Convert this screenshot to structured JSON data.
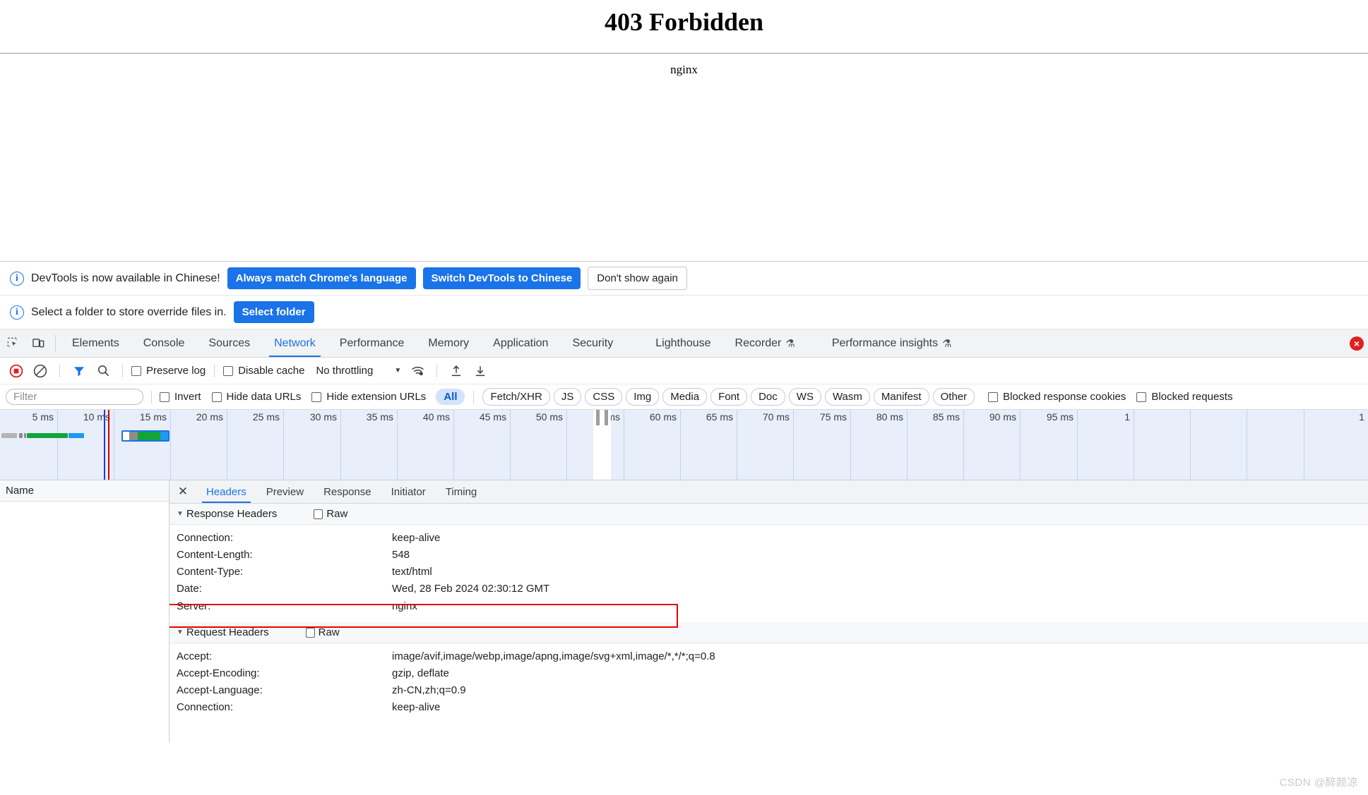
{
  "page": {
    "title": "403 Forbidden",
    "server": "nginx"
  },
  "notifications": [
    {
      "icon": "info-icon",
      "text": "DevTools is now available in Chinese!",
      "primary_button": "Always match Chrome's language",
      "secondary_button": "Switch DevTools to Chinese",
      "tertiary_button": "Don't show again"
    },
    {
      "icon": "info-icon",
      "text": "Select a folder to store override files in.",
      "primary_button": "Select folder"
    }
  ],
  "devtools": {
    "left_icons": [
      "inspect-element-icon",
      "device-toolbar-icon"
    ],
    "tabs": [
      {
        "label": "Elements",
        "active": false,
        "experimental": false
      },
      {
        "label": "Console",
        "active": false,
        "experimental": false
      },
      {
        "label": "Sources",
        "active": false,
        "experimental": false
      },
      {
        "label": "Network",
        "active": true,
        "experimental": false
      },
      {
        "label": "Performance",
        "active": false,
        "experimental": false
      },
      {
        "label": "Memory",
        "active": false,
        "experimental": false
      },
      {
        "label": "Application",
        "active": false,
        "experimental": false
      },
      {
        "label": "Security",
        "active": false,
        "experimental": false
      },
      {
        "label": "Lighthouse",
        "active": false,
        "experimental": false
      },
      {
        "label": "Recorder",
        "active": false,
        "experimental": true
      },
      {
        "label": "Performance insights",
        "active": false,
        "experimental": true
      }
    ],
    "error_badge": "×",
    "accent_color": "#1a73e8",
    "error_color": "#e02020"
  },
  "network_toolbar": {
    "record_icon": "record-stop-icon",
    "clear_icon": "clear-network-log-icon",
    "filter_icon": "filter-funnel-icon",
    "search_icon": "search-icon",
    "preserve_log_label": "Preserve log",
    "preserve_log_checked": false,
    "disable_cache_label": "Disable cache",
    "disable_cache_checked": false,
    "throttling_value": "No throttling",
    "network_conditions_icon": "wifi-settings-icon",
    "import_har_icon": "import-har-icon",
    "export_har_icon": "export-har-icon"
  },
  "filter_bar": {
    "filter_placeholder": "Filter",
    "filter_value": "",
    "invert_label": "Invert",
    "invert_checked": false,
    "hide_data_urls_label": "Hide data URLs",
    "hide_data_urls_checked": false,
    "hide_extension_urls_label": "Hide extension URLs",
    "hide_extension_urls_checked": false,
    "type_filters": [
      {
        "label": "All",
        "active": true
      },
      {
        "label": "Fetch/XHR",
        "active": false
      },
      {
        "label": "JS",
        "active": false
      },
      {
        "label": "CSS",
        "active": false
      },
      {
        "label": "Img",
        "active": false
      },
      {
        "label": "Media",
        "active": false
      },
      {
        "label": "Font",
        "active": false
      },
      {
        "label": "Doc",
        "active": false
      },
      {
        "label": "WS",
        "active": false
      },
      {
        "label": "Wasm",
        "active": false
      },
      {
        "label": "Manifest",
        "active": false
      },
      {
        "label": "Other",
        "active": false
      }
    ],
    "blocked_response_cookies_label": "Blocked response cookies",
    "blocked_response_cookies_checked": false,
    "blocked_requests_label": "Blocked requests",
    "blocked_requests_checked": false
  },
  "overview": {
    "ticks": [
      "5 ms",
      "10 ms",
      "15 ms",
      "20 ms",
      "25 ms",
      "30 ms",
      "35 ms",
      "40 ms",
      "45 ms",
      "50 ms",
      "55 ms",
      "60 ms",
      "65 ms",
      "70 ms",
      "75 ms",
      "80 ms",
      "85 ms",
      "90 ms",
      "95 ms",
      "1"
    ],
    "dom_content_loaded_color": "#1a3fd4",
    "load_event_color": "#d40000",
    "waterfall_colors": {
      "queueing": "#b4b4b4",
      "stalled": "#9e9e9e",
      "waiting": "#12a43b",
      "download": "#1a9bf0"
    }
  },
  "request_list": {
    "column_header": "Name",
    "rows": []
  },
  "detail_panel": {
    "close_icon": "close-icon",
    "tabs": [
      {
        "label": "Headers",
        "active": true
      },
      {
        "label": "Preview",
        "active": false
      },
      {
        "label": "Response",
        "active": false
      },
      {
        "label": "Initiator",
        "active": false
      },
      {
        "label": "Timing",
        "active": false
      }
    ],
    "response_headers": {
      "section_title": "Response Headers",
      "raw_label": "Raw",
      "raw_checked": false,
      "rows": [
        {
          "name": "Connection:",
          "value": "keep-alive",
          "highlighted": false
        },
        {
          "name": "Content-Length:",
          "value": "548",
          "highlighted": false
        },
        {
          "name": "Content-Type:",
          "value": "text/html",
          "highlighted": false
        },
        {
          "name": "Date:",
          "value": "Wed, 28 Feb 2024 02:30:12 GMT",
          "highlighted": false
        },
        {
          "name": "Server:",
          "value": "nginx",
          "highlighted": true
        }
      ]
    },
    "request_headers": {
      "section_title": "Request Headers",
      "raw_label": "Raw",
      "raw_checked": false,
      "rows": [
        {
          "name": "Accept:",
          "value": "image/avif,image/webp,image/apng,image/svg+xml,image/*,*/*;q=0.8"
        },
        {
          "name": "Accept-Encoding:",
          "value": "gzip, deflate"
        },
        {
          "name": "Accept-Language:",
          "value": "zh-CN,zh;q=0.9"
        },
        {
          "name": "Connection:",
          "value": "keep-alive"
        }
      ]
    },
    "highlight_color": "#e80000"
  },
  "watermark": "CSDN @醉颜凉"
}
